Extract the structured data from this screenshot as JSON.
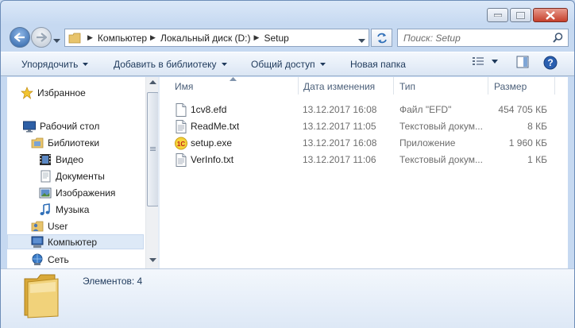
{
  "window": {
    "caption_buttons": [
      "minimize",
      "maximize",
      "close"
    ]
  },
  "address_bar": {
    "breadcrumbs": [
      "Компьютер",
      "Локальный диск (D:)",
      "Setup"
    ]
  },
  "search": {
    "placeholder": "Поиск: Setup"
  },
  "toolbar": {
    "organize": "Упорядочить",
    "add_to_library": "Добавить в библиотеку",
    "share": "Общий доступ",
    "new_folder": "Новая папка"
  },
  "nav_pane": {
    "favorites": "Избранное",
    "desktop": "Рабочий стол",
    "libraries": "Библиотеки",
    "video": "Видео",
    "documents": "Документы",
    "images": "Изображения",
    "music": "Музыка",
    "user": "User",
    "computer": "Компьютер",
    "network": "Сеть"
  },
  "columns": {
    "name": "Имя",
    "date": "Дата изменения",
    "type": "Тип",
    "size": "Размер"
  },
  "files": [
    {
      "name": "1cv8.efd",
      "date": "13.12.2017 16:08",
      "type": "Файл \"EFD\"",
      "size": "454 705 КБ",
      "icon": "generic-file-icon"
    },
    {
      "name": "ReadMe.txt",
      "date": "13.12.2017 11:05",
      "type": "Текстовый докум...",
      "size": "8 КБ",
      "icon": "text-file-icon"
    },
    {
      "name": "setup.exe",
      "date": "13.12.2017 16:08",
      "type": "Приложение",
      "size": "1 960 КБ",
      "icon": "1c-app-icon"
    },
    {
      "name": "VerInfo.txt",
      "date": "13.12.2017 11:06",
      "type": "Текстовый докум...",
      "size": "1 КБ",
      "icon": "text-file-icon"
    }
  ],
  "details": {
    "items_count": "Элементов: 4"
  },
  "colors": {
    "window_frame": "#c6d9f1",
    "selection": "#dde9f7",
    "toolbar_text": "#1e395b",
    "secondary_text": "#6d6d6d"
  }
}
